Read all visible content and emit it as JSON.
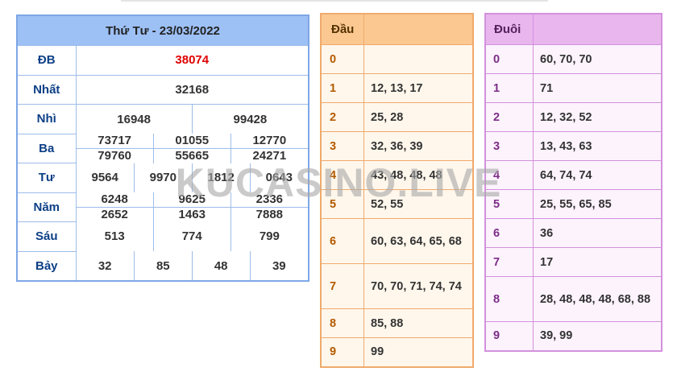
{
  "results": {
    "title": "Thứ Tư - 23/03/2022",
    "prizes": [
      {
        "name": "ĐB",
        "rows": [
          [
            "38074"
          ]
        ]
      },
      {
        "name": "Nhất",
        "rows": [
          [
            "32168"
          ]
        ]
      },
      {
        "name": "Nhì",
        "rows": [
          [
            "16948",
            "99428"
          ]
        ]
      },
      {
        "name": "Ba",
        "rows": [
          [
            "73717",
            "01055",
            "12770"
          ],
          [
            "79760",
            "55665",
            "24271"
          ]
        ]
      },
      {
        "name": "Tư",
        "rows": [
          [
            "9564",
            "9970",
            "1812",
            "0643"
          ]
        ]
      },
      {
        "name": "Năm",
        "rows": [
          [
            "6248",
            "9625",
            "2336"
          ],
          [
            "2652",
            "1463",
            "7888"
          ]
        ]
      },
      {
        "name": "Sáu",
        "rows": [
          [
            "513",
            "774",
            "799"
          ]
        ]
      },
      {
        "name": "Bảy",
        "rows": [
          [
            "32",
            "85",
            "48",
            "39"
          ]
        ]
      }
    ]
  },
  "heads": {
    "header": "Đầu",
    "header_value": "",
    "rows": [
      {
        "digit": "0",
        "values": ""
      },
      {
        "digit": "1",
        "values": "12, 13, 17"
      },
      {
        "digit": "2",
        "values": "25, 28"
      },
      {
        "digit": "3",
        "values": "32, 36, 39"
      },
      {
        "digit": "4",
        "values": "43, 48, 48, 48"
      },
      {
        "digit": "5",
        "values": "52, 55"
      },
      {
        "digit": "6",
        "values": "60, 63, 64, 65, 68"
      },
      {
        "digit": "7",
        "values": "70, 70, 71, 74, 74"
      },
      {
        "digit": "8",
        "values": "85, 88"
      },
      {
        "digit": "9",
        "values": "99"
      }
    ]
  },
  "tails": {
    "header": "Đuôi",
    "header_value": "",
    "rows": [
      {
        "digit": "0",
        "values": "60, 70, 70"
      },
      {
        "digit": "1",
        "values": "71"
      },
      {
        "digit": "2",
        "values": "12, 32, 52"
      },
      {
        "digit": "3",
        "values": "13, 43, 63"
      },
      {
        "digit": "4",
        "values": "64, 74, 74"
      },
      {
        "digit": "5",
        "values": "25, 55, 65, 85"
      },
      {
        "digit": "6",
        "values": "36"
      },
      {
        "digit": "7",
        "values": "17"
      },
      {
        "digit": "8",
        "values": "28, 48, 48, 48, 68, 88"
      },
      {
        "digit": "9",
        "values": "39, 99"
      }
    ]
  },
  "watermark": "KUCASINO.LIVE",
  "colors": {
    "results_header": "#9dc0f5",
    "results_border": "#7ea7e6",
    "special_prize": "#e00000",
    "heads_header": "#fbc892",
    "heads_border": "#f0aa6c",
    "tails_header": "#e9b6ee",
    "tails_border": "#d391dc"
  }
}
